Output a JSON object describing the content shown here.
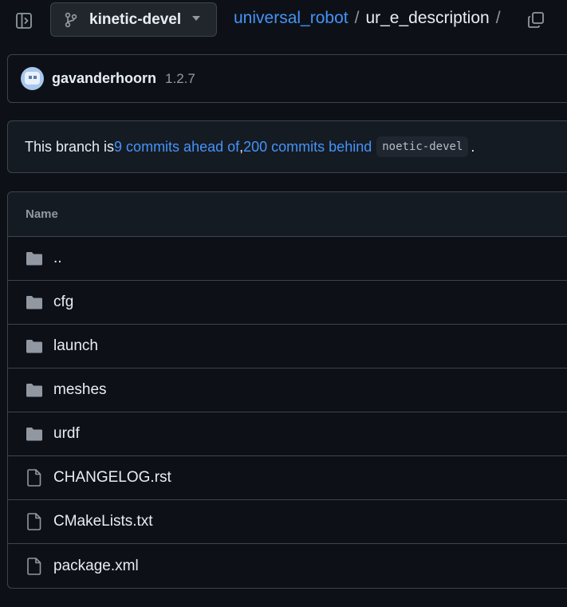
{
  "topbar": {
    "sidebar_toggle_icon": "sidebar-collapse-icon",
    "branch": {
      "name": "kinetic-devel",
      "icon": "git-branch-icon"
    },
    "breadcrumb": {
      "repo": "universal_robot",
      "separator": "/",
      "current": "ur_e_description",
      "trailing_separator": "/"
    },
    "copy_icon": "copy-icon"
  },
  "latest_commit": {
    "author": "gavanderhoorn",
    "version": "1.2.7"
  },
  "branch_status": {
    "prefix": "This branch is ",
    "ahead": "9 commits ahead of",
    "comma": ", ",
    "behind": "200 commits behind",
    "base_branch": "noetic-devel",
    "suffix": "."
  },
  "file_table": {
    "header_name": "Name",
    "rows": [
      {
        "name": "..",
        "type": "folder"
      },
      {
        "name": "cfg",
        "type": "folder"
      },
      {
        "name": "launch",
        "type": "folder"
      },
      {
        "name": "meshes",
        "type": "folder"
      },
      {
        "name": "urdf",
        "type": "folder"
      },
      {
        "name": "CHANGELOG.rst",
        "type": "file"
      },
      {
        "name": "CMakeLists.txt",
        "type": "file"
      },
      {
        "name": "package.xml",
        "type": "file"
      }
    ]
  },
  "colors": {
    "background": "#0d1117",
    "link": "#4493f8",
    "border": "#3d444d",
    "muted": "#9198a1",
    "icon": "#9198a1"
  }
}
